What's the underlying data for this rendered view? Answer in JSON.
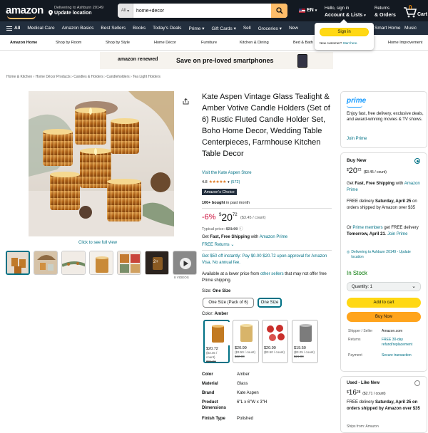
{
  "header": {
    "logo": "amazon",
    "deliver_line1": "Delivering to Ashburn 20149",
    "deliver_line2": "Update location",
    "search_category": "All",
    "search_value": "home+decor",
    "lang": "EN",
    "account_line1": "Hello, sign in",
    "account_line2": "Account & Lists",
    "orders_line1": "Returns",
    "orders_line2": "& Orders",
    "cart_count": "0",
    "cart_label": "Cart"
  },
  "nav": {
    "all_label": "All",
    "items": [
      "Medical Care",
      "Amazon Basics",
      "Best Sellers",
      "Books",
      "Today's Deals",
      "Prime",
      "Gift Cards",
      "Sell",
      "Groceries",
      "New",
      "Smart Home",
      "Music"
    ]
  },
  "popover": {
    "signin": "Sign in",
    "new_customer": "New customer?",
    "start_here": "Start here."
  },
  "subnav": {
    "items": [
      "Amazon Home",
      "Shop by Room",
      "Shop by Style",
      "Home Décor",
      "Furniture",
      "Kitchen & Dining",
      "Bed & Bath",
      "Home Improvement"
    ]
  },
  "banner": {
    "logo": "amazon renewed",
    "text": "Save on pre-loved smartphones"
  },
  "breadcrumb": [
    "Home & Kitchen",
    "Home Décor Products",
    "Candles & Holders",
    "Candleholders",
    "Tea Light Holders"
  ],
  "gallery": {
    "full_view": "Click to see full view",
    "videos_label": "8 VIDEOS",
    "thumb_badge": "2+"
  },
  "product": {
    "title": "Kate Aspen Vintage Glass Tealight & Amber Votive Candle Holders (Set of 6) Rustic Fluted Candle Holder Set, Boho Home Decor, Wedding Table Centerpieces, Farmhouse Kitchen Table Decor",
    "store": "Visit the Kate Aspen Store",
    "rating": "4.8",
    "rating_count": "(572)",
    "stars_fraction": 0.96,
    "choice": "Amazon's Choice",
    "bought_bold": "100+ bought",
    "bought_rest": " in past month",
    "discount": "-6%",
    "price_dollars": "20",
    "price_cents": "72",
    "price_symbol": "$",
    "unit_price": "($3.45 / count)",
    "typical_label": "Typical price: ",
    "typical_price": "$21.99",
    "get_label": "Get ",
    "fast_free": "Fast, Free Shipping",
    "with_label": " with ",
    "amazon_prime": "Amazon Prime",
    "free_returns": "FREE Returns",
    "offer": "Get $50 off instantly: Pay $0.00 $20.72 upon approval for Amazon Visa. No annual fee.",
    "lower_price_a": "Available at a lower price from ",
    "lower_price_link": "other sellers",
    "lower_price_b": " that may not offer free Prime shipping.",
    "size_label": "Size: ",
    "size_value": "One Size",
    "size_options": [
      "One Size (Pack of 6)",
      "One Size"
    ],
    "color_label": "Color: ",
    "color_value": "Amber",
    "swatches": [
      {
        "price": "$20.72",
        "unit": "($3.45 / count)",
        "old": "$21.99"
      },
      {
        "price": "$20.99",
        "unit": "($3.50 / count)",
        "old": "$22.00"
      },
      {
        "price": "$20.99",
        "unit": "($3.50 / count)",
        "old": ""
      },
      {
        "price": "$19.50",
        "unit": "($3.25 / count)",
        "old": "$21.00"
      }
    ],
    "specs": [
      {
        "k": "Color",
        "v": "Amber"
      },
      {
        "k": "Material",
        "v": "Glass"
      },
      {
        "k": "Brand",
        "v": "Kate Aspen"
      },
      {
        "k": "Product Dimensions",
        "v": "6\"L x 6\"W x 3\"H"
      },
      {
        "k": "Finish Type",
        "v": "Polished"
      }
    ]
  },
  "prime_box": {
    "logo": "prime",
    "text": "Enjoy fast, free delivery, exclusive deals, and award-winning movies & TV shows.",
    "join": "Join Prime"
  },
  "buy_box": {
    "title": "Buy New",
    "price_dollars": "20",
    "price_cents": "72",
    "unit": "($3.45 / count)",
    "free_ship_a": "Get ",
    "free_ship_bold": "Fast, Free Shipping",
    "free_ship_b": " with ",
    "free_ship_link": "Amazon Prime",
    "delivery_a": "FREE delivery ",
    "delivery_bold": "Saturday, April 25",
    "delivery_b": " on orders shipped by Amazon over $35",
    "fast_a": "Or ",
    "fast_link": "Prime members",
    "fast_b": " get FREE delivery ",
    "fast_bold": "Tomorrow, April 21",
    "fast_c": ". ",
    "fast_join": "Join Prime",
    "location": "Delivering to Ashburn 20149 - Update location",
    "in_stock": "In Stock",
    "quantity": "Quantity: 1",
    "add_to_cart": "Add to cart",
    "buy_now": "Buy Now",
    "meta": [
      {
        "k": "Shipper / Seller",
        "v": "Amazon.com"
      },
      {
        "k": "Returns",
        "v": "FREE 30-day refund/replacement"
      },
      {
        "k": "Payment",
        "v": "Secure transaction"
      }
    ]
  },
  "used_box": {
    "title": "Used - Like New",
    "price_dollars": "16",
    "price_cents": "28",
    "unit": "($2.71 / count)",
    "delivery_a": "FREE delivery ",
    "delivery_bold": "Saturday, April 25 on orders shipped by Amazon over $35",
    "ships_from": "Ships from: Amazon"
  },
  "colors": {
    "header_bg": "#131921",
    "nav_bg": "#232f3e",
    "link": "#007185",
    "deal_red": "#cc0c39",
    "add_to_cart": "#ffd814",
    "buy_now": "#ffa41c",
    "in_stock": "#007600",
    "prime_blue": "#1399ff"
  }
}
